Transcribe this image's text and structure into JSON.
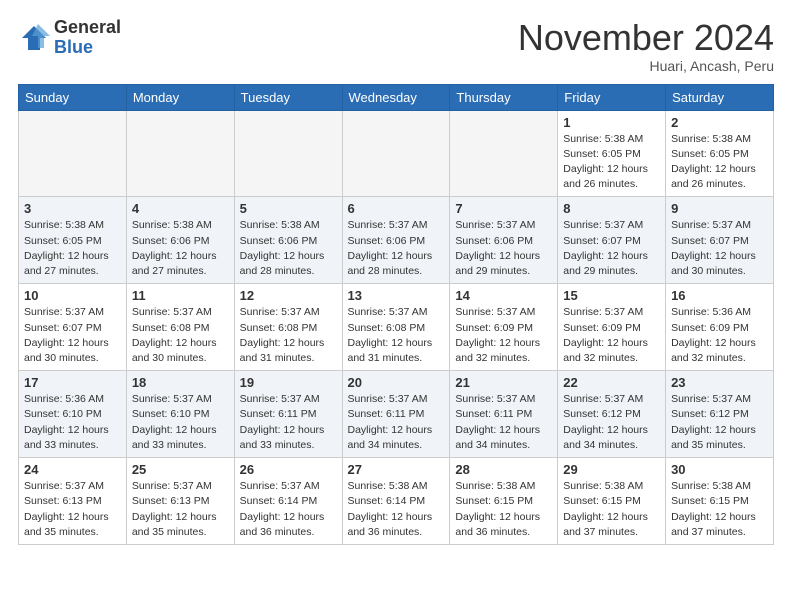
{
  "logo": {
    "general": "General",
    "blue": "Blue"
  },
  "header": {
    "month": "November 2024",
    "location": "Huari, Ancash, Peru"
  },
  "weekdays": [
    "Sunday",
    "Monday",
    "Tuesday",
    "Wednesday",
    "Thursday",
    "Friday",
    "Saturday"
  ],
  "weeks": [
    [
      {
        "day": "",
        "info": ""
      },
      {
        "day": "",
        "info": ""
      },
      {
        "day": "",
        "info": ""
      },
      {
        "day": "",
        "info": ""
      },
      {
        "day": "",
        "info": ""
      },
      {
        "day": "1",
        "info": "Sunrise: 5:38 AM\nSunset: 6:05 PM\nDaylight: 12 hours and 26 minutes."
      },
      {
        "day": "2",
        "info": "Sunrise: 5:38 AM\nSunset: 6:05 PM\nDaylight: 12 hours and 26 minutes."
      }
    ],
    [
      {
        "day": "3",
        "info": "Sunrise: 5:38 AM\nSunset: 6:05 PM\nDaylight: 12 hours and 27 minutes."
      },
      {
        "day": "4",
        "info": "Sunrise: 5:38 AM\nSunset: 6:06 PM\nDaylight: 12 hours and 27 minutes."
      },
      {
        "day": "5",
        "info": "Sunrise: 5:38 AM\nSunset: 6:06 PM\nDaylight: 12 hours and 28 minutes."
      },
      {
        "day": "6",
        "info": "Sunrise: 5:37 AM\nSunset: 6:06 PM\nDaylight: 12 hours and 28 minutes."
      },
      {
        "day": "7",
        "info": "Sunrise: 5:37 AM\nSunset: 6:06 PM\nDaylight: 12 hours and 29 minutes."
      },
      {
        "day": "8",
        "info": "Sunrise: 5:37 AM\nSunset: 6:07 PM\nDaylight: 12 hours and 29 minutes."
      },
      {
        "day": "9",
        "info": "Sunrise: 5:37 AM\nSunset: 6:07 PM\nDaylight: 12 hours and 30 minutes."
      }
    ],
    [
      {
        "day": "10",
        "info": "Sunrise: 5:37 AM\nSunset: 6:07 PM\nDaylight: 12 hours and 30 minutes."
      },
      {
        "day": "11",
        "info": "Sunrise: 5:37 AM\nSunset: 6:08 PM\nDaylight: 12 hours and 30 minutes."
      },
      {
        "day": "12",
        "info": "Sunrise: 5:37 AM\nSunset: 6:08 PM\nDaylight: 12 hours and 31 minutes."
      },
      {
        "day": "13",
        "info": "Sunrise: 5:37 AM\nSunset: 6:08 PM\nDaylight: 12 hours and 31 minutes."
      },
      {
        "day": "14",
        "info": "Sunrise: 5:37 AM\nSunset: 6:09 PM\nDaylight: 12 hours and 32 minutes."
      },
      {
        "day": "15",
        "info": "Sunrise: 5:37 AM\nSunset: 6:09 PM\nDaylight: 12 hours and 32 minutes."
      },
      {
        "day": "16",
        "info": "Sunrise: 5:36 AM\nSunset: 6:09 PM\nDaylight: 12 hours and 32 minutes."
      }
    ],
    [
      {
        "day": "17",
        "info": "Sunrise: 5:36 AM\nSunset: 6:10 PM\nDaylight: 12 hours and 33 minutes."
      },
      {
        "day": "18",
        "info": "Sunrise: 5:37 AM\nSunset: 6:10 PM\nDaylight: 12 hours and 33 minutes."
      },
      {
        "day": "19",
        "info": "Sunrise: 5:37 AM\nSunset: 6:11 PM\nDaylight: 12 hours and 33 minutes."
      },
      {
        "day": "20",
        "info": "Sunrise: 5:37 AM\nSunset: 6:11 PM\nDaylight: 12 hours and 34 minutes."
      },
      {
        "day": "21",
        "info": "Sunrise: 5:37 AM\nSunset: 6:11 PM\nDaylight: 12 hours and 34 minutes."
      },
      {
        "day": "22",
        "info": "Sunrise: 5:37 AM\nSunset: 6:12 PM\nDaylight: 12 hours and 34 minutes."
      },
      {
        "day": "23",
        "info": "Sunrise: 5:37 AM\nSunset: 6:12 PM\nDaylight: 12 hours and 35 minutes."
      }
    ],
    [
      {
        "day": "24",
        "info": "Sunrise: 5:37 AM\nSunset: 6:13 PM\nDaylight: 12 hours and 35 minutes."
      },
      {
        "day": "25",
        "info": "Sunrise: 5:37 AM\nSunset: 6:13 PM\nDaylight: 12 hours and 35 minutes."
      },
      {
        "day": "26",
        "info": "Sunrise: 5:37 AM\nSunset: 6:14 PM\nDaylight: 12 hours and 36 minutes."
      },
      {
        "day": "27",
        "info": "Sunrise: 5:38 AM\nSunset: 6:14 PM\nDaylight: 12 hours and 36 minutes."
      },
      {
        "day": "28",
        "info": "Sunrise: 5:38 AM\nSunset: 6:15 PM\nDaylight: 12 hours and 36 minutes."
      },
      {
        "day": "29",
        "info": "Sunrise: 5:38 AM\nSunset: 6:15 PM\nDaylight: 12 hours and 37 minutes."
      },
      {
        "day": "30",
        "info": "Sunrise: 5:38 AM\nSunset: 6:15 PM\nDaylight: 12 hours and 37 minutes."
      }
    ]
  ]
}
